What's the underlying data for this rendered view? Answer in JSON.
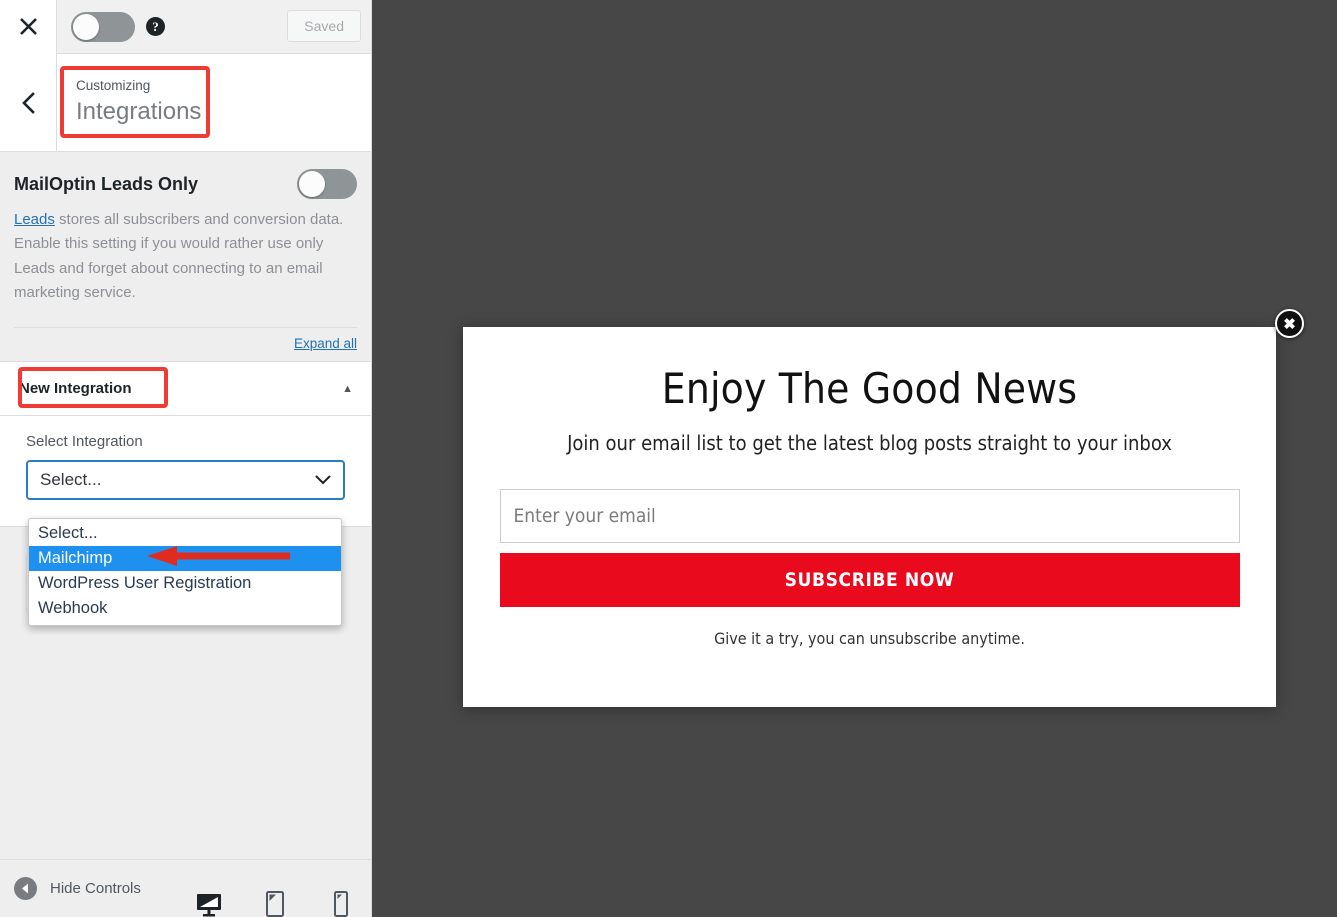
{
  "customizer": {
    "header": {
      "close_icon": "close-icon",
      "device_toggle_icon": "toggle-switch",
      "help_icon": "help-icon",
      "save_label": "Saved"
    },
    "titlebar": {
      "back_icon": "chevron-left-icon",
      "subtitle": "Customizing",
      "title": "Integrations"
    },
    "leads_section": {
      "title": "MailOptin Leads Only",
      "toggle_state": "off",
      "description_link": "Leads",
      "description_rest": " stores all subscribers and conversion data. Enable this setting if you would rather use only Leads and forget about connecting to an email marketing service."
    },
    "expand_all_label": "Expand all",
    "accordion": {
      "label": "New Integration",
      "caret_icon": "chevron-up-icon",
      "field_label": "Select Integration",
      "select_value": "Select...",
      "select_caret_icon": "chevron-down-icon",
      "options": [
        {
          "label": "Select...",
          "selected": false
        },
        {
          "label": "Mailchimp",
          "selected": true
        },
        {
          "label": "WordPress User Registration",
          "selected": false
        },
        {
          "label": "Webhook",
          "selected": false
        }
      ]
    },
    "footer": {
      "hide_controls_label": "Hide Controls",
      "hide_icon": "arrow-left-circle-icon",
      "devices": [
        {
          "name": "desktop-preview-icon",
          "active": true
        },
        {
          "name": "tablet-preview-icon",
          "active": false
        },
        {
          "name": "mobile-preview-icon",
          "active": false
        }
      ]
    },
    "annotations": {
      "title_box_color": "#ee3b33",
      "new_integration_box_color": "#ee3b33",
      "arrow_color": "#e02b20"
    }
  },
  "preview": {
    "background_color": "#474747",
    "popup": {
      "close_icon": "close-circle-icon",
      "headline": "Enjoy The Good News",
      "subheadline": "Join our email list to get the latest blog posts straight to your inbox",
      "email_placeholder": "Enter your email",
      "submit_label": "SUBSCRIBE NOW",
      "submit_color": "#ea0a1e",
      "note": "Give it a try, you can unsubscribe anytime."
    }
  }
}
